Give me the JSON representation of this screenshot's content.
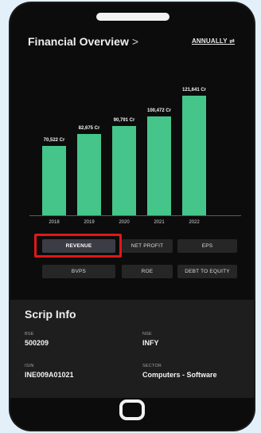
{
  "header": {
    "title": "Financial Overview",
    "chevron": ">",
    "period": "ANNUALLY",
    "period_icon": "swap-icon"
  },
  "chart_data": {
    "type": "bar",
    "categories": [
      "2018",
      "2019",
      "2020",
      "2021",
      "2022"
    ],
    "values": [
      70522,
      82675,
      90791,
      100472,
      121641
    ],
    "labels": [
      "70,522 Cr",
      "82,675 Cr",
      "90,791 Cr",
      "100,472 Cr",
      "121,641 Cr"
    ],
    "title": "",
    "xlabel": "",
    "ylabel": "",
    "ylim": [
      0,
      121641
    ],
    "bar_color": "#45c58a",
    "grid": false
  },
  "metric_buttons": [
    {
      "label": "REVENUE",
      "active": true
    },
    {
      "label": "NET PROFIT",
      "active": false
    },
    {
      "label": "EPS",
      "active": false
    },
    {
      "label": "BVPS",
      "active": false
    },
    {
      "label": "ROE",
      "active": false
    },
    {
      "label": "DEBT TO EQUITY",
      "active": false
    }
  ],
  "scrip": {
    "title": "Scrip Info",
    "bse_label": "BSE",
    "bse_value": "500209",
    "nse_label": "NSE",
    "nse_value": "INFY",
    "isin_label": "ISIN",
    "isin_value": "INE009A01021",
    "sector_label": "SECTOR",
    "sector_value": "Computers - Software"
  },
  "colors": {
    "highlight": "#e01818",
    "background": "#0c0c0c",
    "accent": "#45c58a"
  }
}
